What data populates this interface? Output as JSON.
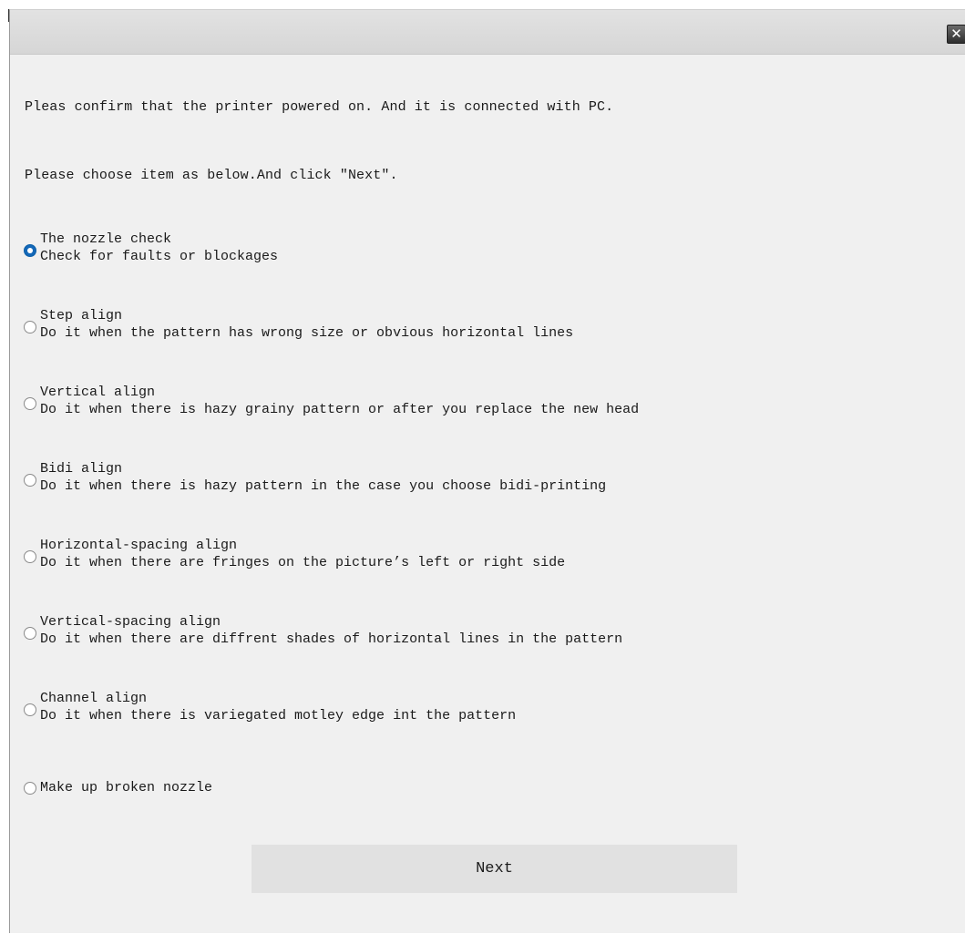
{
  "window": {
    "close_label": "✕"
  },
  "messages": {
    "confirm": "Pleas confirm that the printer powered on. And it is connected with PC.",
    "instruction": "Please choose item as below.And click \"Next\"."
  },
  "options": [
    {
      "title": "The nozzle check",
      "desc": "Check for faults or blockages",
      "checked": true
    },
    {
      "title": "Step align",
      "desc": "Do it when the pattern has wrong size or obvious horizontal lines",
      "checked": false
    },
    {
      "title": "Vertical align",
      "desc": "Do it when there is hazy grainy pattern or after you replace the new head",
      "checked": false
    },
    {
      "title": "Bidi align",
      "desc": "Do it when there is hazy pattern in the case you choose bidi-printing",
      "checked": false
    },
    {
      "title": "Horizontal-spacing align",
      "desc": "Do it when there are fringes on the picture’s left or right side",
      "checked": false
    },
    {
      "title": "Vertical-spacing align",
      "desc": "Do it when there are diffrent shades of horizontal lines in the pattern",
      "checked": false
    },
    {
      "title": "Channel align",
      "desc": "Do it when there is variegated motley edge int the pattern",
      "checked": false
    },
    {
      "title": "Make up broken nozzle",
      "desc": "",
      "checked": false
    }
  ],
  "buttons": {
    "next": "Next"
  },
  "colors": {
    "window_bg": "#f0f0f0",
    "radio_selected": "#1468b8",
    "button_bg": "#e1e1e1"
  }
}
